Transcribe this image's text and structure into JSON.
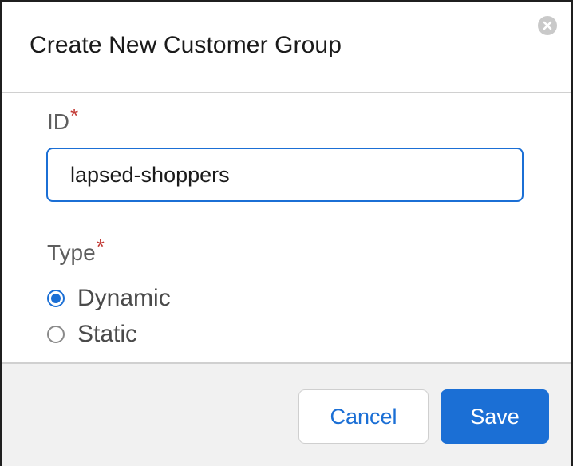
{
  "modal": {
    "title": "Create New Customer Group",
    "close_icon": "close-circle-icon"
  },
  "form": {
    "id_field": {
      "label": "ID",
      "required_marker": "*",
      "value": "lapsed-shoppers"
    },
    "type_field": {
      "label": "Type",
      "required_marker": "*",
      "options": [
        {
          "label": "Dynamic",
          "selected": true
        },
        {
          "label": "Static",
          "selected": false
        }
      ]
    }
  },
  "footer": {
    "cancel_label": "Cancel",
    "save_label": "Save"
  },
  "colors": {
    "accent": "#1b6fd5",
    "required": "#c23934",
    "footer_bg": "#f1f1f1"
  }
}
